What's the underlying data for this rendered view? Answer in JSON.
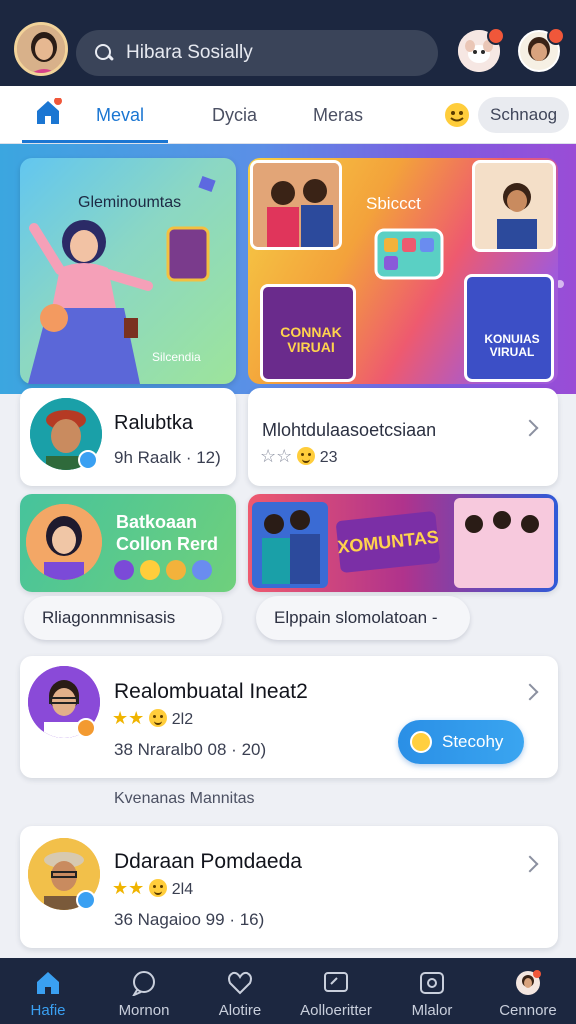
{
  "header": {
    "search_placeholder": "Hibara Sosially",
    "notifications": [
      "bell-icon",
      "profile-icon"
    ]
  },
  "tabs": {
    "items": [
      {
        "label": "Meval",
        "active": true
      },
      {
        "label": "Dycia"
      },
      {
        "label": "Meras"
      }
    ],
    "pill_label": "Schnaog"
  },
  "banner": {
    "left_title": "Gleminoumtas",
    "left_subtitle": "Silcendia",
    "right_title": "Sbiccct",
    "poster_left": "CONNAK VIRUAI",
    "poster_right": "KONUIAS VIRUAL"
  },
  "cards_row1": {
    "left": {
      "title": "Ralubtka",
      "meta": "9h Raalk · 12)"
    },
    "right": {
      "title": "Mlohtdulaasoetcsiaan",
      "meta": "23"
    }
  },
  "cards_row2": {
    "left": {
      "line1": "Batkoaan",
      "line2": "Collon Rerd"
    },
    "right": {
      "banner_text": "XOMUNTAS"
    }
  },
  "chips": [
    "Rliagonnmnisasis",
    "Elppain slomolatoan -"
  ],
  "list": [
    {
      "title": "Realombuatal Ineat2",
      "rating": "2l2",
      "meta": "38  Nraralb0 08 · 20)"
    },
    {
      "title": "Ddaraan Pomdaeda",
      "rating": "2l4",
      "meta": "36  Nagaioo 99 · 16)"
    }
  ],
  "cta_label": "Stecohy",
  "section_label": "Kvenanas Mannitas",
  "bottom_nav": [
    {
      "label": "Hafie",
      "icon": "home-icon",
      "active": true
    },
    {
      "label": "Mornon",
      "icon": "chat-icon"
    },
    {
      "label": "Alotire",
      "icon": "heart-icon"
    },
    {
      "label": "Aolloeritter",
      "icon": "message-icon"
    },
    {
      "label": "Mlalor",
      "icon": "camera-icon"
    },
    {
      "label": "Cennore",
      "icon": "profile-icon"
    }
  ],
  "colors": {
    "primary": "#1b76d2",
    "dark_bar": "#1c2740",
    "accent_orange": "#f0573a",
    "star": "#f0b400"
  }
}
